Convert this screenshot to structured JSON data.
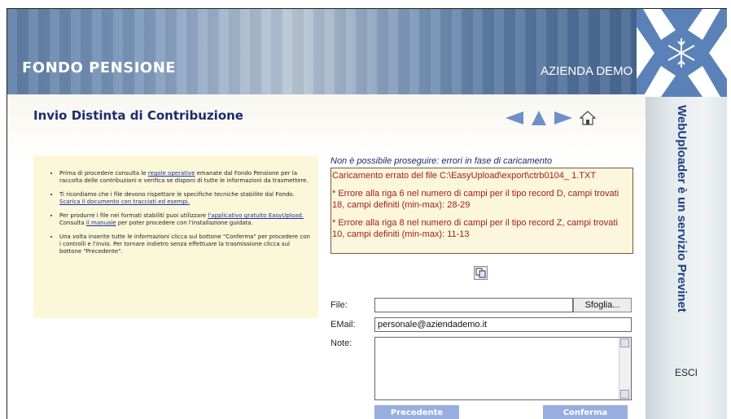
{
  "header": {
    "brand": "FONDO PENSIONE",
    "company": "AZIENDA DEMO"
  },
  "page": {
    "title": "Invio Distinta di Contribuzione"
  },
  "nav_icons": [
    "arrow-left-icon",
    "arrow-up-icon",
    "arrow-right-icon",
    "home-icon"
  ],
  "sidebar": {
    "vertical_text": "WebUploader è un servizio Previnet",
    "exit": "ESCI"
  },
  "info": {
    "items": [
      {
        "pre": "Prima di procedere consulta le ",
        "link": "regole operative",
        "post": " emanate dal Fondo Pensione per la raccolta delle contribuzioni e verifica se disponi di tutte le informazioni da trasmettere."
      },
      {
        "pre": "Ti ricordiamo che i file devono rispettare le specifiche tecniche stabilite dal Fondo. ",
        "link": "Scarica il documento con tracciati ed esempi.",
        "post": ""
      },
      {
        "pre": "Per produrre i file nei formati stabiliti puoi utilizzare ",
        "link": "l'applicativo gratuito EasyUpload.",
        "post": " Consulta ",
        "link2": "il manuale",
        "post2": " per poter procedere con l'installazione guidata."
      },
      {
        "pre": "Una volta inserite tutte le informazioni clicca sul bottone \"Conferma\" per procedere con i controlli e l'invio. Per tornare indietro senza effettuare la trasmissione clicca sul bottone \"Precedente\".",
        "link": "",
        "post": ""
      }
    ]
  },
  "errors": {
    "title": "Non è possibile proseguire: errori in fase di caricamento",
    "lines": [
      "Caricamento errato del file C:\\EasyUpload\\export\\ctrb0104_ 1.TXT",
      "* Errore alla riga 6 nel numero di campi per il tipo record D, campi trovati 18, campi definiti (min-max): 28-29",
      "* Errore alla riga 8 nel numero di campi per il tipo record Z, campi trovati 10, campi definiti (min-max): 11-13"
    ]
  },
  "form": {
    "file_label": "File:",
    "file_value": "",
    "browse_label": "Sfoglia...",
    "email_label": "EMail:",
    "email_value": "personale@aziendademo.it",
    "note_label": "Note:",
    "note_value": ""
  },
  "actions": {
    "back": "Precedente",
    "confirm": "Conferma"
  },
  "colors": {
    "accent": "#1d2c6e",
    "button": "#98aede",
    "error": "#a31d1d",
    "nav": "#6f8fc9"
  }
}
